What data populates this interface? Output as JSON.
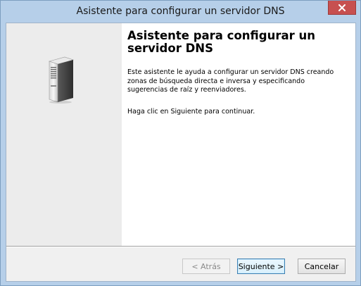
{
  "window": {
    "title": "Asistente para configurar un servidor DNS"
  },
  "wizard": {
    "heading": "Asistente para configurar un servidor DNS",
    "description": "Este asistente le ayuda a configurar un servidor DNS creando zonas de búsqueda directa e inversa y especificando sugerencias de raíz y reenviadores.",
    "continue_text": "Haga clic en Siguiente para continuar."
  },
  "buttons": {
    "back_label": "< Atrás",
    "next_label": "Siguiente >",
    "cancel_label": "Cancelar"
  },
  "icons": {
    "close": "close-icon",
    "server": "server-icon"
  },
  "colors": {
    "close_button": "#c75050",
    "window_frame": "#b6cfe9",
    "side_panel": "#ececec"
  }
}
